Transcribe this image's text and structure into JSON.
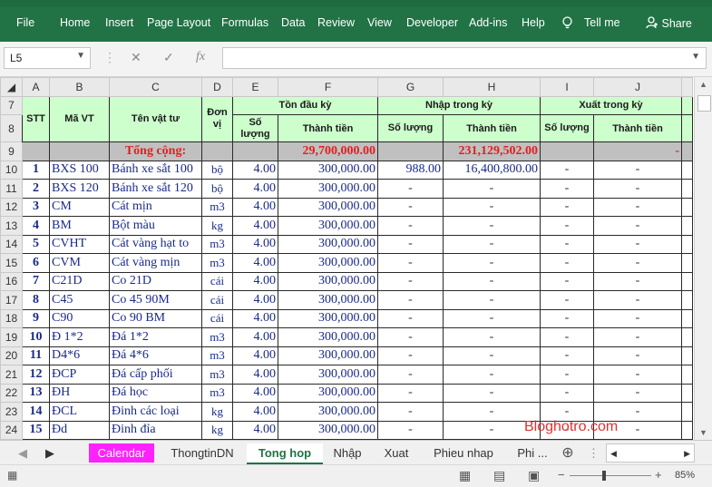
{
  "ribbon": {
    "tabs": [
      "File",
      "Home",
      "Insert",
      "Page Layout",
      "Formulas",
      "Data",
      "Review",
      "View",
      "Developer",
      "Add-ins",
      "Help",
      "Tell me",
      "Share"
    ]
  },
  "formula_bar": {
    "name_box": "L5",
    "fx": "fx",
    "value": ""
  },
  "columns": [
    "A",
    "B",
    "C",
    "D",
    "E",
    "F",
    "G",
    "H",
    "I",
    "J"
  ],
  "header": {
    "stt": "STT",
    "ma_vt": "Mã VT",
    "ten_vat_tu": "Tên vật tư",
    "don_vi": "Đơn vị",
    "ton_dau_ky": "Tồn đầu kỳ",
    "nhap_trong_ky": "Nhập trong kỳ",
    "xuat_trong_ky": "Xuất trong kỳ",
    "so_luong": "Số lượng",
    "thanh_tien": "Thành tiền"
  },
  "total_row": {
    "row": "9",
    "label": "Tổng cộng:",
    "ton_thanh_tien": "29,700,000.00",
    "nhap_thanh_tien": "231,129,502.00",
    "xuat_thanh_tien": "-"
  },
  "rows": [
    {
      "row": "10",
      "stt": "1",
      "ma": "BXS 100",
      "ten": "Bánh xe sắt 100",
      "dv": "bộ",
      "sl": "4.00",
      "tt": "300,000.00",
      "nsl": "988.00",
      "ntt": "16,400,800.00",
      "xsl": "-",
      "xtt": "-"
    },
    {
      "row": "11",
      "stt": "2",
      "ma": "BXS 120",
      "ten": "Bánh xe sắt 120",
      "dv": "bộ",
      "sl": "4.00",
      "tt": "300,000.00",
      "nsl": "-",
      "ntt": "-",
      "xsl": "-",
      "xtt": "-"
    },
    {
      "row": "12",
      "stt": "3",
      "ma": "CM",
      "ten": "Cát mịn",
      "dv": "m3",
      "sl": "4.00",
      "tt": "300,000.00",
      "nsl": "-",
      "ntt": "-",
      "xsl": "-",
      "xtt": "-"
    },
    {
      "row": "13",
      "stt": "4",
      "ma": "BM",
      "ten": "Bột màu",
      "dv": "kg",
      "sl": "4.00",
      "tt": "300,000.00",
      "nsl": "-",
      "ntt": "-",
      "xsl": "-",
      "xtt": "-"
    },
    {
      "row": "14",
      "stt": "5",
      "ma": "CVHT",
      "ten": "Cát vàng hạt to",
      "dv": "m3",
      "sl": "4.00",
      "tt": "300,000.00",
      "nsl": "-",
      "ntt": "-",
      "xsl": "-",
      "xtt": "-"
    },
    {
      "row": "15",
      "stt": "6",
      "ma": "CVM",
      "ten": "Cát vàng mịn",
      "dv": "m3",
      "sl": "4.00",
      "tt": "300,000.00",
      "nsl": "-",
      "ntt": "-",
      "xsl": "-",
      "xtt": "-"
    },
    {
      "row": "16",
      "stt": "7",
      "ma": "C21D",
      "ten": "Co 21D",
      "dv": "cái",
      "sl": "4.00",
      "tt": "300,000.00",
      "nsl": "-",
      "ntt": "-",
      "xsl": "-",
      "xtt": "-"
    },
    {
      "row": "17",
      "stt": "8",
      "ma": "C45",
      "ten": "Co 45 90M",
      "dv": "cái",
      "sl": "4.00",
      "tt": "300,000.00",
      "nsl": "-",
      "ntt": "-",
      "xsl": "-",
      "xtt": "-"
    },
    {
      "row": "18",
      "stt": "9",
      "ma": "C90",
      "ten": "Co 90 BM",
      "dv": "cái",
      "sl": "4.00",
      "tt": "300,000.00",
      "nsl": "-",
      "ntt": "-",
      "xsl": "-",
      "xtt": "-"
    },
    {
      "row": "19",
      "stt": "10",
      "ma": "Đ 1*2",
      "ten": "Đá 1*2",
      "dv": "m3",
      "sl": "4.00",
      "tt": "300,000.00",
      "nsl": "-",
      "ntt": "-",
      "xsl": "-",
      "xtt": "-"
    },
    {
      "row": "20",
      "stt": "11",
      "ma": "D4*6",
      "ten": "Đá 4*6",
      "dv": "m3",
      "sl": "4.00",
      "tt": "300,000.00",
      "nsl": "-",
      "ntt": "-",
      "xsl": "-",
      "xtt": "-"
    },
    {
      "row": "21",
      "stt": "12",
      "ma": "ĐCP",
      "ten": "Đá cấp phối",
      "dv": "m3",
      "sl": "4.00",
      "tt": "300,000.00",
      "nsl": "-",
      "ntt": "-",
      "xsl": "-",
      "xtt": "-"
    },
    {
      "row": "22",
      "stt": "13",
      "ma": "ĐH",
      "ten": "Đá học",
      "dv": "m3",
      "sl": "4.00",
      "tt": "300,000.00",
      "nsl": "-",
      "ntt": "-",
      "xsl": "-",
      "xtt": "-"
    },
    {
      "row": "23",
      "stt": "14",
      "ma": "ĐCL",
      "ten": "Đinh các loại",
      "dv": "kg",
      "sl": "4.00",
      "tt": "300,000.00",
      "nsl": "-",
      "ntt": "-",
      "xsl": "-",
      "xtt": "-"
    },
    {
      "row": "24",
      "stt": "15",
      "ma": "Đd",
      "ten": "Đinh đỉa",
      "dv": "kg",
      "sl": "4.00",
      "tt": "300,000.00",
      "nsl": "-",
      "ntt": "-",
      "xsl": "-",
      "xtt": "-"
    }
  ],
  "sheet_tabs": [
    "Calendar",
    "ThongtinDN",
    "Tong hop",
    "Nhập",
    "Xuat",
    "Phieu nhap",
    "Phi ..."
  ],
  "active_tab": "Tong hop",
  "watermark": "Bloghotro.com",
  "status": {
    "zoom": "85%"
  }
}
